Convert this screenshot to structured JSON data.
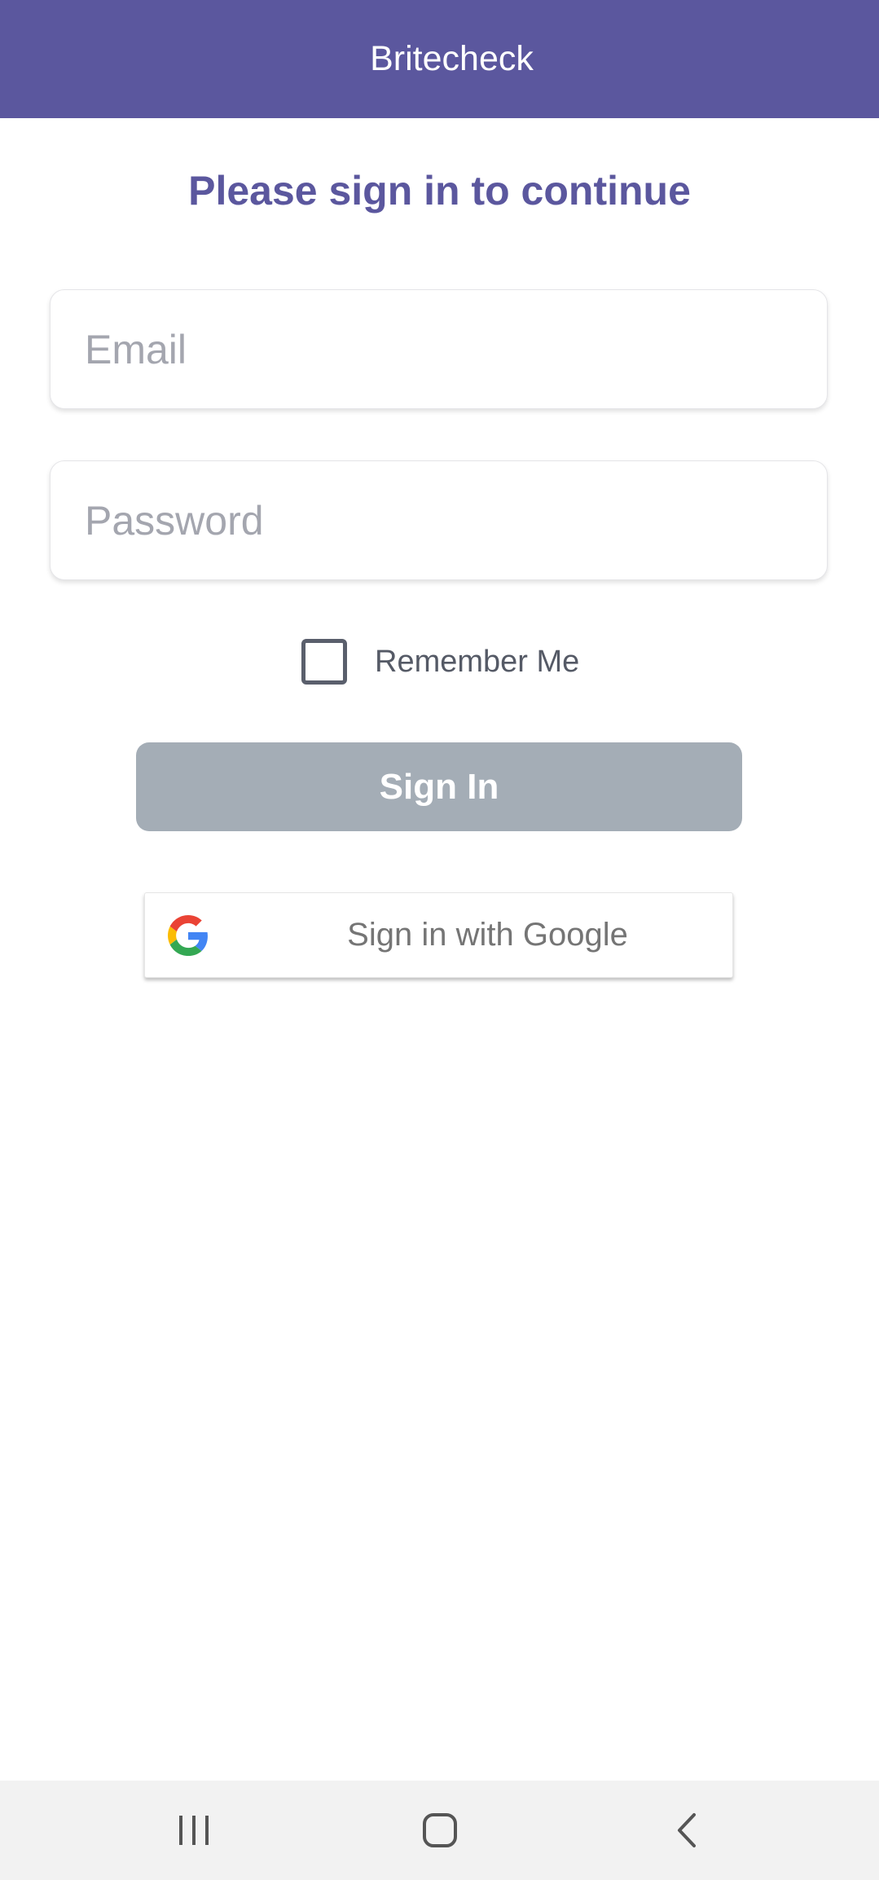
{
  "app": {
    "title": "Britecheck",
    "accent": "#5b579e"
  },
  "main": {
    "heading": "Please sign in to continue",
    "email": {
      "placeholder": "Email",
      "value": ""
    },
    "password": {
      "placeholder": "Password",
      "value": ""
    },
    "remember_me": {
      "label": "Remember Me",
      "checked": false
    },
    "sign_in_label": "Sign In",
    "google_label": "Sign in with Google",
    "google_icon": "google-g-icon"
  },
  "navbar": {
    "recents_icon": "recents-icon",
    "home_icon": "home-icon",
    "back_icon": "back-icon"
  }
}
